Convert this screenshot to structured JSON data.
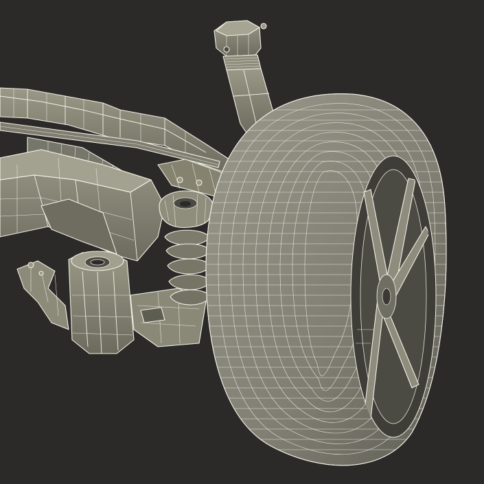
{
  "scene": {
    "subject": "",
    "background_color": "#2b2a28",
    "body_color": "#8d8b7a",
    "body_shadow_color": "#5f5e53",
    "wire_color": "#f4f2e8",
    "tire_color": "#86857a",
    "rim_color": "#3f3e39"
  }
}
